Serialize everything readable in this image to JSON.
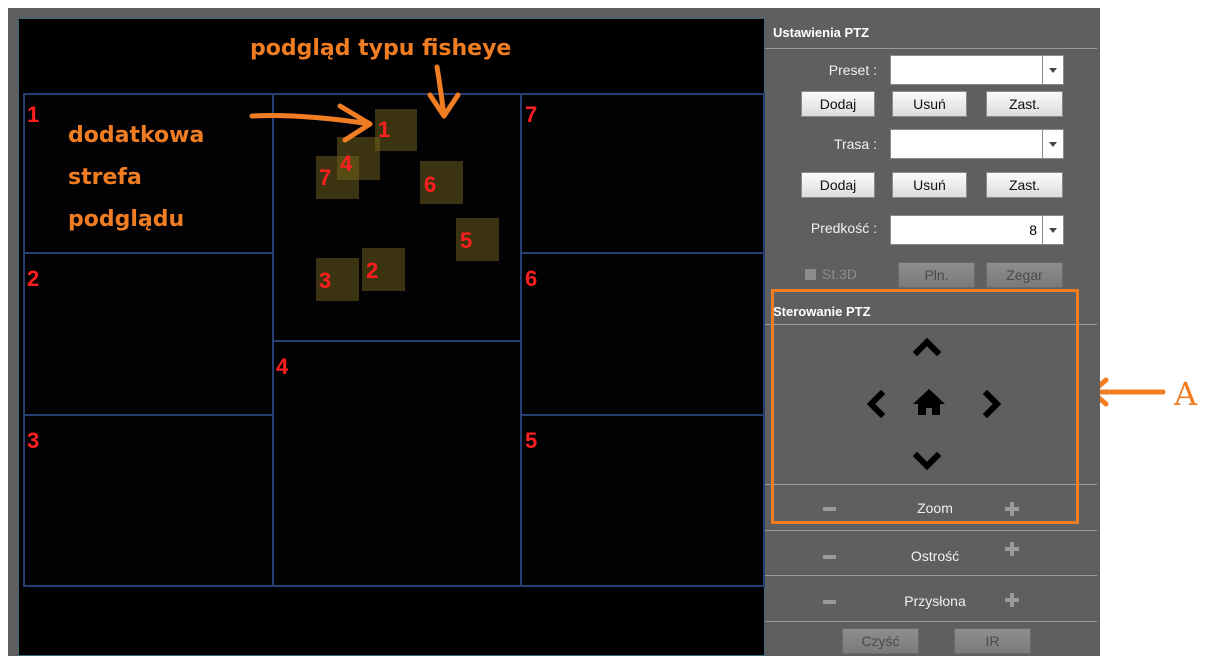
{
  "annotations": {
    "fisheye_label": "podgląd typu fisheye",
    "extra_zone_line1": "dodatkowa",
    "extra_zone_line2": "strefa",
    "extra_zone_line3": "podglądu",
    "marker": "A"
  },
  "grid": {
    "cell_numbers": [
      "1",
      "2",
      "3",
      "4",
      "5",
      "6",
      "7"
    ]
  },
  "fisheye_rois": [
    "1",
    "4",
    "7",
    "6",
    "5",
    "3",
    "2"
  ],
  "ptz_settings": {
    "title": "Ustawienia PTZ",
    "preset_label": "Preset :",
    "preset_value": "",
    "add_label": "Dodaj",
    "delete_label": "Usuń",
    "apply_label": "Zast.",
    "route_label": "Trasa :",
    "route_value": "",
    "speed_label": "Predkość :",
    "speed_value": "8",
    "st3d_label": "St.3D",
    "pan_label": "Pln.",
    "clock_label": "Zegar"
  },
  "ptz_control": {
    "title": "Sterowanie PTZ",
    "zoom_label": "Zoom",
    "focus_label": "Ostrość",
    "iris_label": "Przysłona",
    "clear_label": "Czyść",
    "ir_label": "IR"
  },
  "colors": {
    "accent": "#f07d22",
    "grid_line": "#253e73",
    "number": "#ff1e1e",
    "panel": "#5f5f5f"
  }
}
